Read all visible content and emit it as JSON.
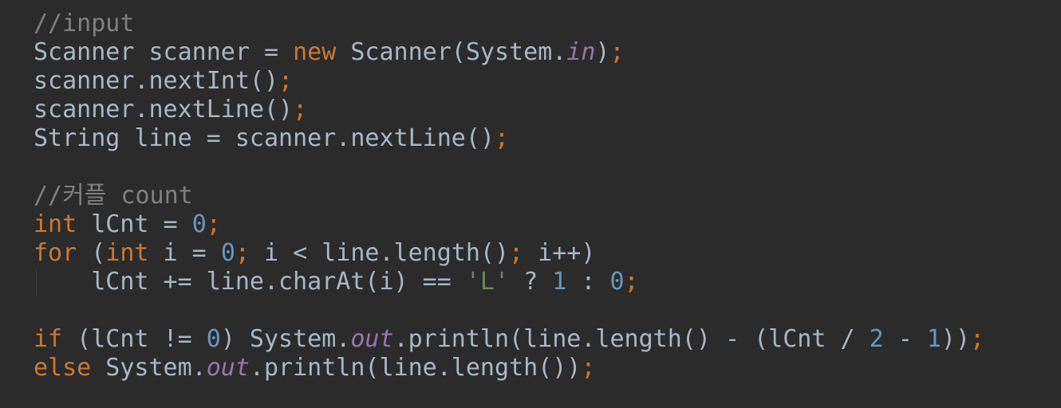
{
  "editor": {
    "background": "#2b2b2b",
    "colors": {
      "plain": "#a9b7c6",
      "keyword": "#cc7832",
      "comment": "#808080",
      "number": "#6897bb",
      "string": "#6a8759",
      "field": "#9876aa"
    },
    "lines": [
      [
        {
          "t": "//input",
          "k": "comment"
        }
      ],
      [
        {
          "t": "Scanner scanner = ",
          "k": "plain"
        },
        {
          "t": "new",
          "k": "keyword"
        },
        {
          "t": " Scanner(System.",
          "k": "plain"
        },
        {
          "t": "in",
          "k": "field"
        },
        {
          "t": ")",
          "k": "plain"
        },
        {
          "t": ";",
          "k": "punct"
        }
      ],
      [
        {
          "t": "scanner.nextInt()",
          "k": "plain"
        },
        {
          "t": ";",
          "k": "punct"
        }
      ],
      [
        {
          "t": "scanner.nextLine()",
          "k": "plain"
        },
        {
          "t": ";",
          "k": "punct"
        }
      ],
      [
        {
          "t": "String line = scanner.nextLine()",
          "k": "plain"
        },
        {
          "t": ";",
          "k": "punct"
        }
      ],
      [],
      [
        {
          "t": "//커플 count",
          "k": "comment"
        }
      ],
      [
        {
          "t": "int",
          "k": "keyword"
        },
        {
          "t": " lCnt = ",
          "k": "plain"
        },
        {
          "t": "0",
          "k": "number"
        },
        {
          "t": ";",
          "k": "punct"
        }
      ],
      [
        {
          "t": "for",
          "k": "keyword"
        },
        {
          "t": " (",
          "k": "plain"
        },
        {
          "t": "int",
          "k": "keyword"
        },
        {
          "t": " i = ",
          "k": "plain"
        },
        {
          "t": "0",
          "k": "number"
        },
        {
          "t": ";",
          "k": "punct"
        },
        {
          "t": " i < line.length()",
          "k": "plain"
        },
        {
          "t": ";",
          "k": "punct"
        },
        {
          "t": " i++)",
          "k": "plain"
        }
      ],
      [
        {
          "t": "    lCnt += line.charAt(i) == ",
          "k": "plain",
          "guide": true
        },
        {
          "t": "'L'",
          "k": "string"
        },
        {
          "t": " ? ",
          "k": "plain"
        },
        {
          "t": "1",
          "k": "number"
        },
        {
          "t": " : ",
          "k": "plain"
        },
        {
          "t": "0",
          "k": "number"
        },
        {
          "t": ";",
          "k": "punct"
        }
      ],
      [],
      [
        {
          "t": "if",
          "k": "keyword"
        },
        {
          "t": " (lCnt != ",
          "k": "plain"
        },
        {
          "t": "0",
          "k": "number"
        },
        {
          "t": ") System.",
          "k": "plain"
        },
        {
          "t": "out",
          "k": "field"
        },
        {
          "t": ".println(line.length() - (lCnt / ",
          "k": "plain"
        },
        {
          "t": "2",
          "k": "number"
        },
        {
          "t": " - ",
          "k": "plain"
        },
        {
          "t": "1",
          "k": "number"
        },
        {
          "t": "))",
          "k": "plain"
        },
        {
          "t": ";",
          "k": "punct"
        }
      ],
      [
        {
          "t": "else",
          "k": "keyword"
        },
        {
          "t": " System.",
          "k": "plain"
        },
        {
          "t": "out",
          "k": "field"
        },
        {
          "t": ".println(line.length())",
          "k": "plain"
        },
        {
          "t": ";",
          "k": "punct"
        }
      ]
    ]
  }
}
